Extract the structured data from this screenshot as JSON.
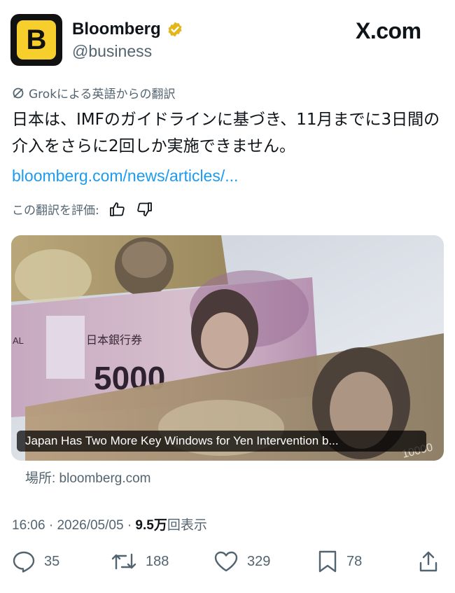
{
  "header": {
    "avatar_letter": "B",
    "display_name": "Bloomberg",
    "handle": "@business",
    "site": "X.com"
  },
  "translation": {
    "label": "Grokによる英語からの翻訳",
    "rate_label": "この翻訳を評価:"
  },
  "post": {
    "text": "日本は、IMFのガイドラインに基づき、11月までに3日間の介入をさらに2回しか実施できません。",
    "link": "bloomberg.com/news/articles/..."
  },
  "card": {
    "caption": "Japan Has Two More Key Windows for Yen Intervention b...",
    "source": "場所: bloomberg.com",
    "image_text": {
      "bank": "日本銀行券",
      "denomination": "5000",
      "side_mark": "AL",
      "back_denom": "10000"
    }
  },
  "meta": {
    "time": "16:06",
    "date": "2026/05/05",
    "views_count": "9.5万",
    "views_label": "回表示",
    "separator": "·"
  },
  "actions": {
    "replies": "35",
    "reposts": "188",
    "likes": "329",
    "bookmarks": "78"
  },
  "colors": {
    "accent_link": "#1d9bf0",
    "secondary_text": "#536471",
    "verified_gold": "#e2b719",
    "avatar_yellow": "#f7cf2c"
  }
}
